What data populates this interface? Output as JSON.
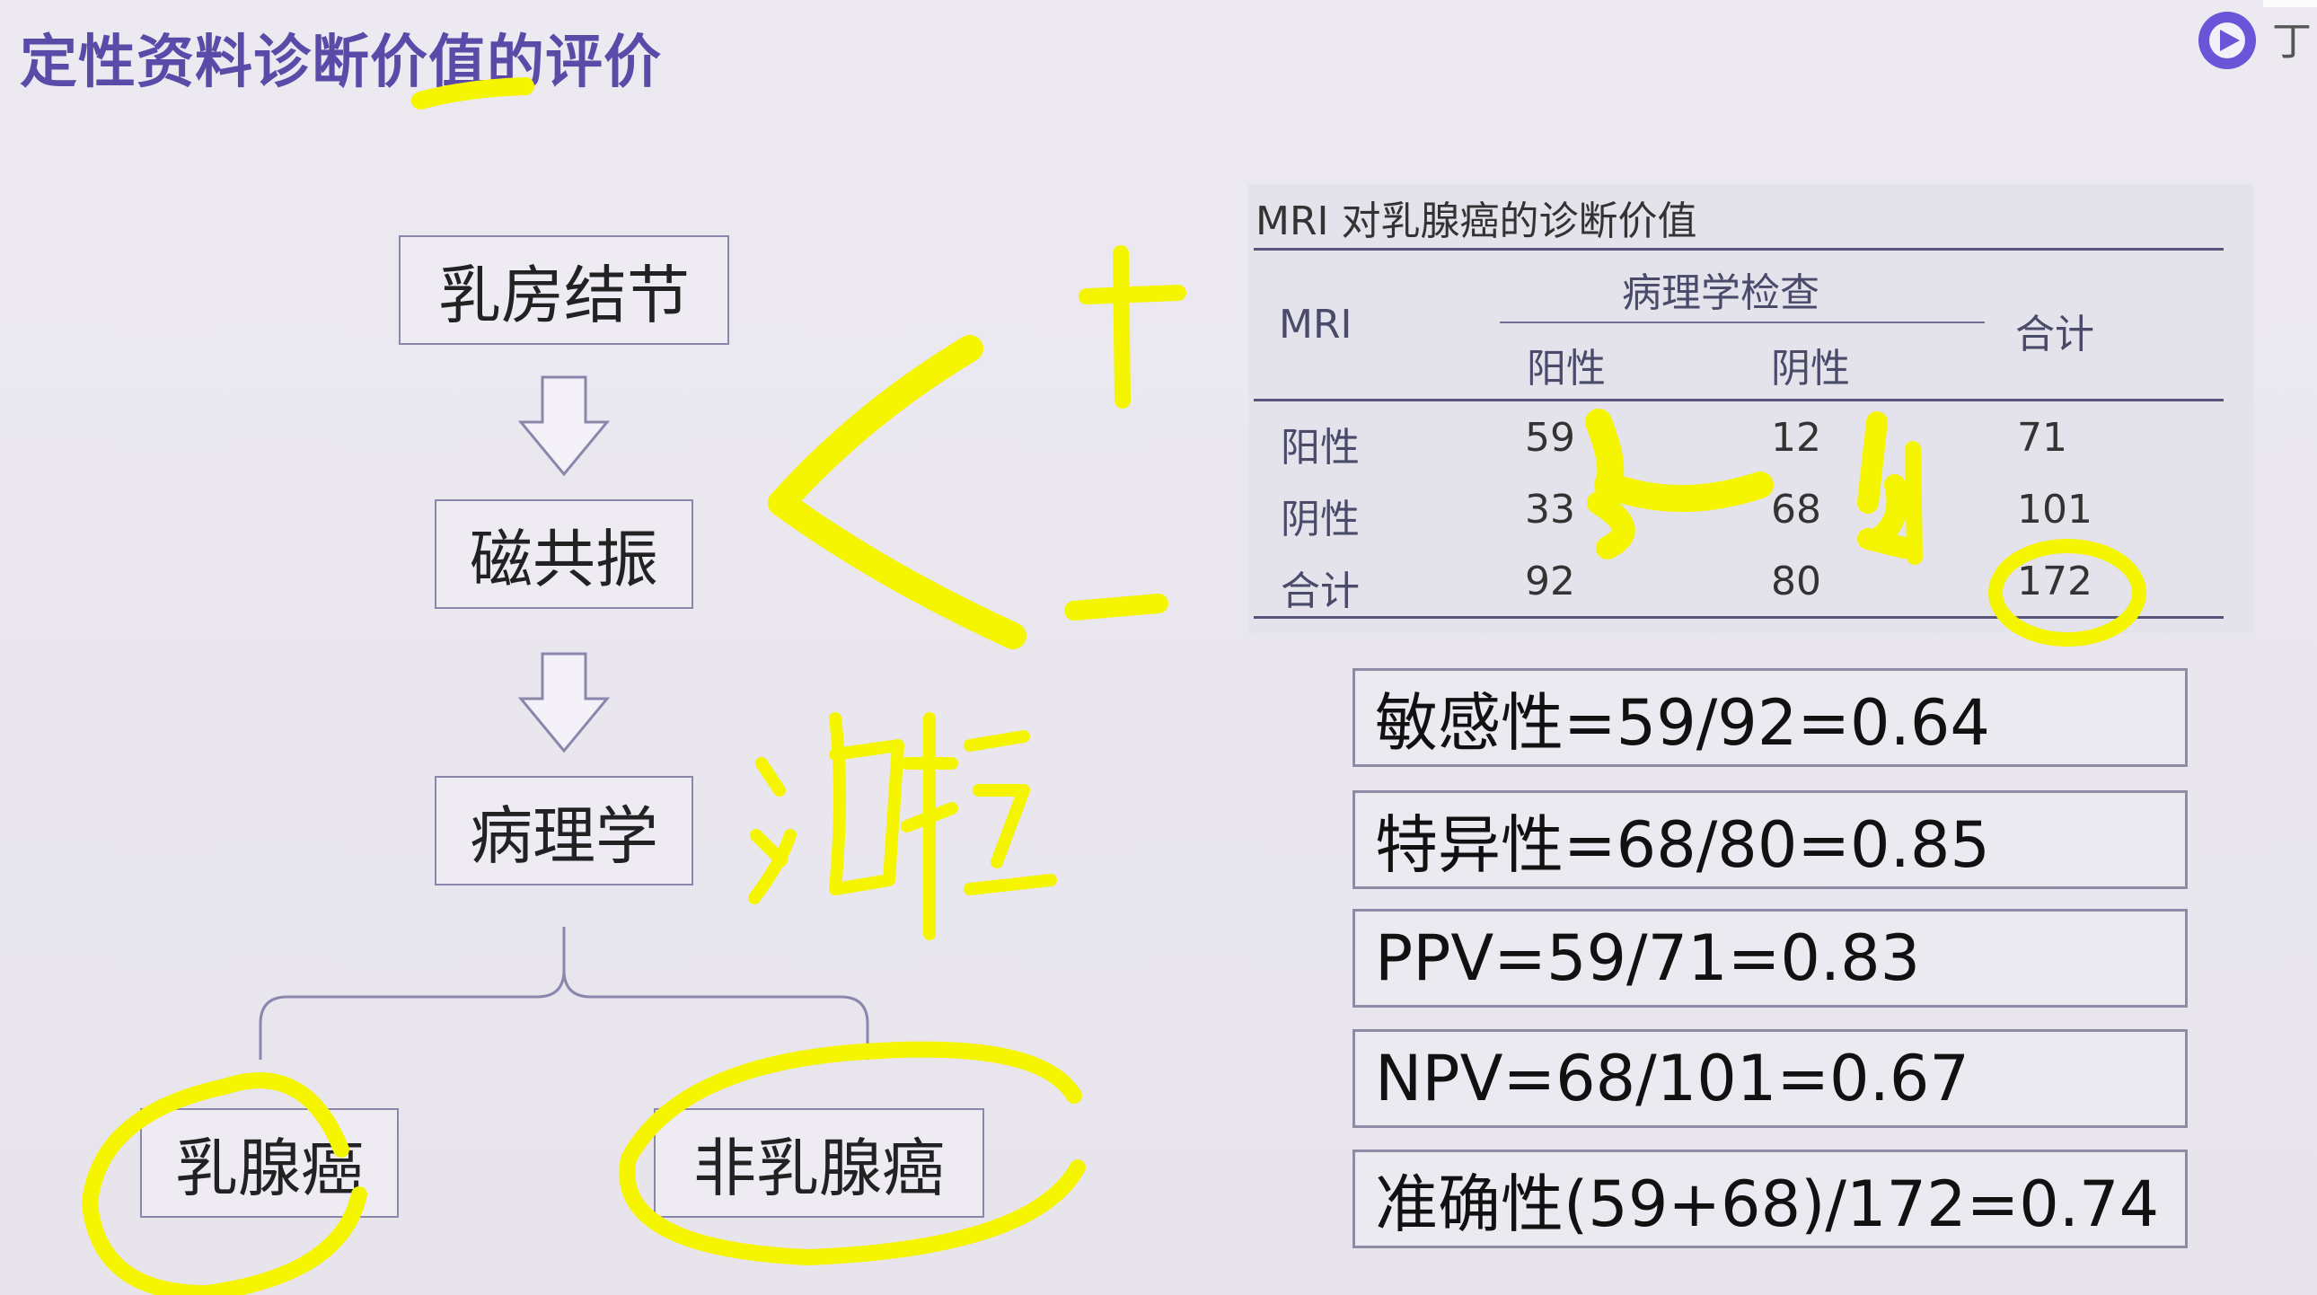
{
  "slide": {
    "title": "定性资料诊断价值的评价",
    "logo_text": "丁"
  },
  "flowchart": {
    "nodes": [
      "乳房结节",
      "磁共振",
      "病理学"
    ],
    "branches": [
      "乳腺癌",
      "非乳腺癌"
    ]
  },
  "table": {
    "caption": "MRI 对乳腺癌的诊断价值",
    "row_header": "MRI",
    "group_header": "病理学检查",
    "total_header": "合计",
    "col_headers": [
      "阳性",
      "阴性"
    ],
    "rows": [
      {
        "label": "阳性",
        "cells": [
          "59",
          "12",
          "71"
        ]
      },
      {
        "label": "阴性",
        "cells": [
          "33",
          "68",
          "101"
        ]
      },
      {
        "label": "合计",
        "cells": [
          "92",
          "80",
          "172"
        ]
      }
    ]
  },
  "results": [
    "敏感性=59/92=0.64",
    "特异性=68/80=0.85",
    "PPV=59/71=0.83",
    "NPV=68/101=0.67",
    "准确性(59+68)/172=0.74"
  ],
  "annotations": {
    "plus": "+",
    "minus": "−",
    "handwriting": "活检"
  },
  "colors": {
    "title": "#5b4ba8",
    "highlighter": "#f5f500",
    "box_border": "#8c86ad"
  }
}
